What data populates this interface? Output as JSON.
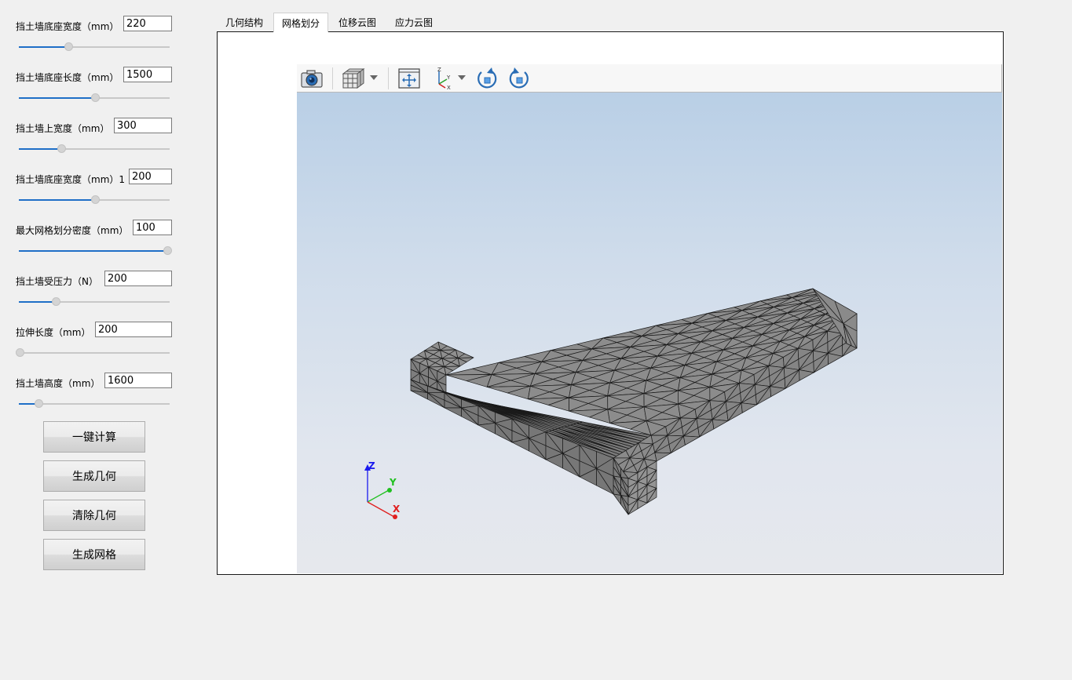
{
  "params": [
    {
      "label": "挡土墙底座宽度（mm）",
      "value": "220",
      "fill_fraction": 0.33
    },
    {
      "label": "挡土墙底座长度（mm）",
      "value": "1500",
      "fill_fraction": 0.5
    },
    {
      "label": "挡土墙上宽度（mm）",
      "value": "300",
      "fill_fraction": 0.28
    },
    {
      "label": "挡土墙底座宽度（mm）1",
      "value": "200",
      "fill_fraction": 0.5
    },
    {
      "label": "最大网格划分密度（mm）",
      "value": "100",
      "fill_fraction": 1.0
    },
    {
      "label": "挡土墙受压力（N）",
      "value": "200",
      "fill_fraction": 0.24
    },
    {
      "label": "拉伸长度（mm）",
      "value": "200",
      "fill_fraction": 0.0
    },
    {
      "label": "挡土墙高度（mm）",
      "value": "1600",
      "fill_fraction": 0.13
    }
  ],
  "buttons": {
    "compute": "一键计算",
    "gen_geometry": "生成几何",
    "clear_geometry": "清除几何",
    "gen_mesh": "生成网格"
  },
  "tabs": [
    {
      "label": "几何结构",
      "active": false
    },
    {
      "label": "网格划分",
      "active": true
    },
    {
      "label": "位移云图",
      "active": false
    },
    {
      "label": "应力云图",
      "active": false
    }
  ],
  "toolbar_icons": [
    "camera-icon",
    "view-cube-icon",
    "fit-view-icon",
    "axis-orientation-icon",
    "rotate-cw-icon",
    "rotate-ccw-icon"
  ],
  "triad": {
    "x": "X",
    "y": "Y",
    "z": "Z"
  },
  "colors": {
    "accent": "#1f6fc7",
    "mesh_face": "#8c8c8c",
    "mesh_edge": "#1a1a1a",
    "axis_x": "#e02020",
    "axis_y": "#20c020",
    "axis_z": "#1a1aee",
    "icon_blue": "#2a6db5"
  }
}
